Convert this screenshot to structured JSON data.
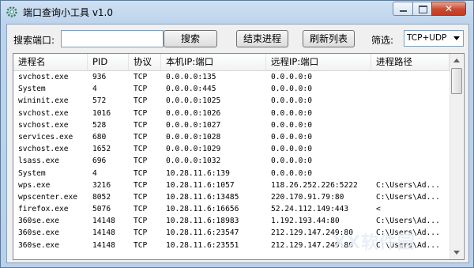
{
  "window": {
    "title": "端口查询小工具  v1.0"
  },
  "toolbar": {
    "search_label": "搜索端口:",
    "search_value": "",
    "search_button": "搜索",
    "end_process_button": "结束进程",
    "refresh_button": "刷新列表",
    "filter_label": "筛选:",
    "filter_value": "TCP+UDP"
  },
  "table": {
    "columns": [
      "进程名",
      "PID",
      "协议",
      "本机IP:端口",
      "远程IP:端口",
      "进程路径"
    ],
    "rows": [
      [
        "svchost.exe",
        "936",
        "TCP",
        "0.0.0.0:135",
        "0.0.0.0:0",
        ""
      ],
      [
        "System",
        "4",
        "TCP",
        "0.0.0.0:445",
        "0.0.0.0:0",
        ""
      ],
      [
        "wininit.exe",
        "572",
        "TCP",
        "0.0.0.0:1025",
        "0.0.0.0:0",
        ""
      ],
      [
        "svchost.exe",
        "1016",
        "TCP",
        "0.0.0.0:1026",
        "0.0.0.0:0",
        ""
      ],
      [
        "svchost.exe",
        "528",
        "TCP",
        "0.0.0.0:1027",
        "0.0.0.0:0",
        ""
      ],
      [
        "services.exe",
        "680",
        "TCP",
        "0.0.0.0:1028",
        "0.0.0.0:0",
        ""
      ],
      [
        "svchost.exe",
        "1652",
        "TCP",
        "0.0.0.0:1029",
        "0.0.0.0:0",
        ""
      ],
      [
        "lsass.exe",
        "696",
        "TCP",
        "0.0.0.0:1032",
        "0.0.0.0:0",
        ""
      ],
      [
        "System",
        "4",
        "TCP",
        "10.28.11.6:139",
        "0.0.0.0:0",
        ""
      ],
      [
        "wps.exe",
        "3216",
        "TCP",
        "10.28.11.6:1057",
        "118.26.252.226:5222",
        "C:\\Users\\Ad..."
      ],
      [
        "wpscenter.exe",
        "8052",
        "TCP",
        "10.28.11.6:13485",
        "220.170.91.79:80",
        "C:\\Users\\Ad..."
      ],
      [
        "firefox.exe",
        "5076",
        "TCP",
        "10.28.11.6:16656",
        "52.24.112.149:443",
        "<"
      ],
      [
        "360se.exe",
        "14148",
        "TCP",
        "10.28.11.6:18983",
        "1.192.193.44:80",
        "C:\\Users\\Ad..."
      ],
      [
        "360se.exe",
        "14148",
        "TCP",
        "10.28.11.6:23547",
        "212.129.147.249:80",
        "C:\\Users\\Ad..."
      ],
      [
        "360se.exe",
        "14148",
        "TCP",
        "10.28.11.6:23551",
        "212.129.147.249:80",
        "C:\\Users\\Ad..."
      ]
    ]
  },
  "watermark": "XX软件园"
}
